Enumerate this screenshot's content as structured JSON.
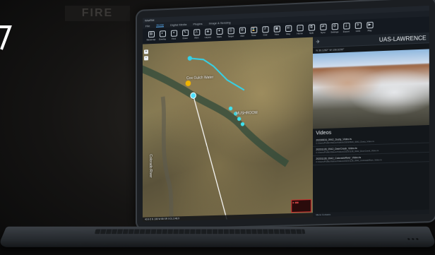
{
  "badge": "FIRE",
  "app": {
    "title": "WarRM"
  },
  "menu": [
    "File",
    "Home",
    "Digital Media",
    "Plugins",
    "Image & Sensing"
  ],
  "ribbon": [
    {
      "icon": "▤",
      "label": "Basemap"
    },
    {
      "icon": "◐",
      "label": "Overlay"
    },
    {
      "icon": "⌖",
      "label": "Find"
    },
    {
      "icon": "✎",
      "label": "Draw"
    },
    {
      "icon": "⚠",
      "label": "Alert"
    },
    {
      "icon": "◈",
      "label": "Layers"
    },
    {
      "icon": "✦",
      "label": "Mark"
    },
    {
      "icon": "◎",
      "label": "Target"
    },
    {
      "icon": "⊕",
      "label": "Add"
    },
    {
      "icon": "⌛",
      "label": "Time"
    },
    {
      "icon": "#",
      "label": "Grid"
    },
    {
      "icon": "▣",
      "label": "Tiles"
    },
    {
      "icon": "✉",
      "label": "Msg"
    },
    {
      "icon": "⌂",
      "label": "Home"
    },
    {
      "icon": "⧉",
      "label": "Split"
    },
    {
      "icon": "⇄",
      "label": "Sync"
    },
    {
      "icon": "⚙",
      "label": "Settings"
    },
    {
      "icon": "⤓",
      "label": "Export"
    },
    {
      "icon": "✈",
      "label": "UAS"
    },
    {
      "icon": "▶",
      "label": "Play"
    }
  ],
  "map": {
    "labels": [
      "Cox Gulch Water",
      "MUSHROOM",
      "Colorado River"
    ],
    "coords": "40.9-5 N 108 W 88 SR  0:01.3:48.9"
  },
  "panel": {
    "name": "UAS-LAWRENCE",
    "sub": "N 39.1282° W 108.6299°",
    "videos_header": "Videos",
    "videos": [
      {
        "title": "20230816_0942_Dusty_Video.ts",
        "sub": "C:/Users/Public/Videos/Videos/2023/0816_0942_Dusty_Video.ts"
      },
      {
        "title": "20231128_0942_DeerCreek_Video.ts",
        "sub": "C:/Users/Public/Videos/Videos/2023/1128_0942_DeerCreek_Video.ts"
      },
      {
        "title": "20231128_0942_ColoradoRiver_Video.ts",
        "sub": "C:/Users/Public/Videos/Videos/2023/1128_0942_ColoradoRiver_Video.ts"
      }
    ],
    "footer": "Menu    Contacts"
  }
}
